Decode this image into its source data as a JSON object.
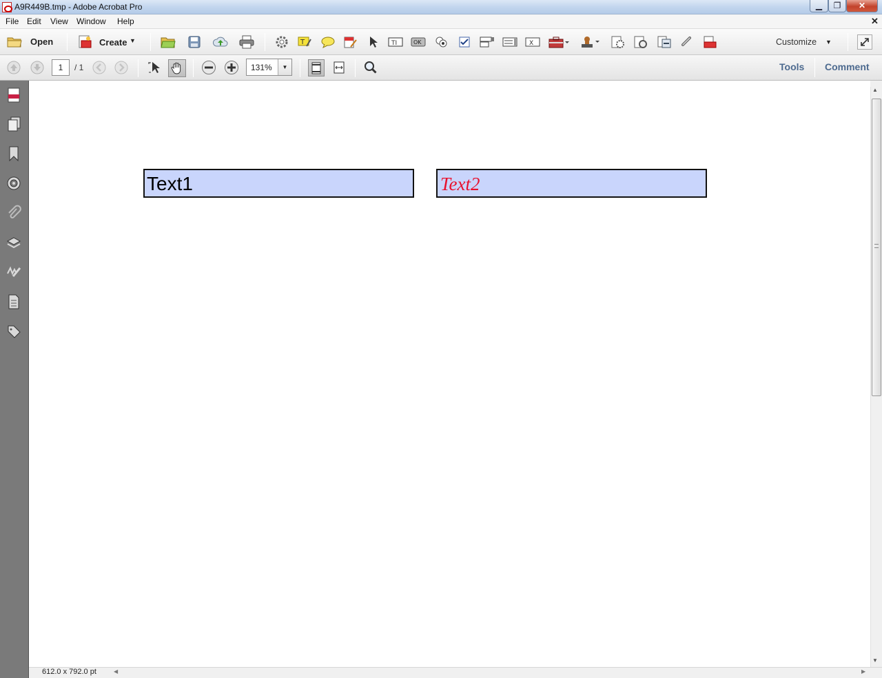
{
  "window": {
    "title": "A9R449B.tmp - Adobe Acrobat Pro",
    "minimize": "▁",
    "maximize": "❐",
    "close": "✕"
  },
  "menu": {
    "items": [
      "File",
      "Edit",
      "View",
      "Window",
      "Help"
    ],
    "close_glyph": "✕"
  },
  "toolbar": {
    "open_label": "Open",
    "create_label": "Create",
    "customize_label": "Customize",
    "icons": [
      "folder-open-icon",
      "save-icon",
      "upload-icon",
      "print-icon",
      "gear-icon",
      "text-field-icon",
      "comment-bubble-icon",
      "edit-form-icon",
      "select-arrow-icon",
      "text-field-tool-icon",
      "button-tool-icon",
      "radio-button-icon",
      "checkbox-icon",
      "dropdown-tool-icon",
      "listbox-tool-icon",
      "barcode-field-icon",
      "toolbox-icon",
      "stamp-icon",
      "action-wizard-icon",
      "form-settings-icon",
      "distribute-form-icon",
      "link-icon",
      "export-pdf-icon"
    ]
  },
  "nav": {
    "page_current": "1",
    "page_total": "/ 1",
    "zoom": "131%",
    "tools_label": "Tools",
    "comment_label": "Comment"
  },
  "document": {
    "field1_text": "Text1",
    "field2_text": "Text2",
    "field_bg": "#c9d5fc",
    "field2_color": "#e8112d"
  },
  "status": {
    "page_size": "612.0 x 792.0 pt"
  },
  "colors": {
    "accent": "#4d6a8f",
    "titlebar": "#c3d6ee",
    "close_button": "#c2432c",
    "leftnav": "#7a7a7a"
  }
}
